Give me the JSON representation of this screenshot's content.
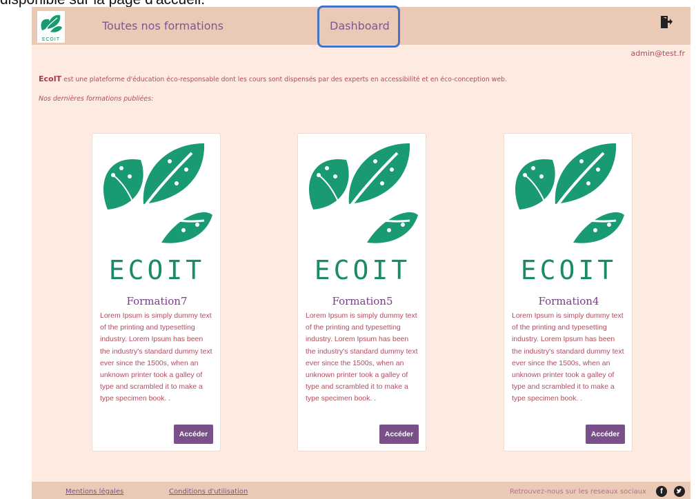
{
  "caption": "disponible sur la page d'accueil.",
  "navbar": {
    "logo_text": "ECOIT",
    "formations_label": "Toutes nos formations",
    "dashboard_label": "Dashboard",
    "logout_icon": "logout-icon"
  },
  "user_email": "admin@test.fr",
  "intro": {
    "brand": "EcoIT",
    "text": " est une plateforme d'éducation éco-responsable dont les cours sont dispensés par des experts en accessibilité et en éco-conception web."
  },
  "subtitle": "Nos dernières formations publiées:",
  "cards": [
    {
      "logo_text": "ECOIT",
      "title": "Formation7",
      "description": "Lorem Ipsum is simply dummy text of the printing and typesetting industry. Lorem Ipsum has been the industry's standard dummy text ever since the 1500s, when an unknown printer took a galley of type and scrambled it to make a type specimen book. .",
      "button_label": "Accéder"
    },
    {
      "logo_text": "ECOIT",
      "title": "Formation5",
      "description": "Lorem Ipsum is simply dummy text of the printing and typesetting industry. Lorem Ipsum has been the industry's standard dummy text ever since the 1500s, when an unknown printer took a galley of type and scrambled it to make a type specimen book. .",
      "button_label": "Accéder"
    },
    {
      "logo_text": "ECOIT",
      "title": "Formation4",
      "description": "Lorem Ipsum is simply dummy text of the printing and typesetting industry. Lorem Ipsum has been the industry's standard dummy text ever since the 1500s, when an unknown printer took a galley of type and scrambled it to make a type specimen book. .",
      "button_label": "Accéder"
    }
  ],
  "footer": {
    "mentions_label": "Mentions légales",
    "conditions_label": "Conditions d'utilisation",
    "social_text": "Retrouvez-nous sur les reseaux sociaux",
    "social_icons": [
      "facebook-icon",
      "twitter-icon"
    ]
  },
  "colors": {
    "page_bg": "#fdeae0",
    "navbar_bg": "#eac9b7",
    "accent_text": "#b44a5c",
    "brand_green": "#1a8a6a",
    "button_bg": "#7a4f8a",
    "highlight_border": "#4472c4"
  }
}
